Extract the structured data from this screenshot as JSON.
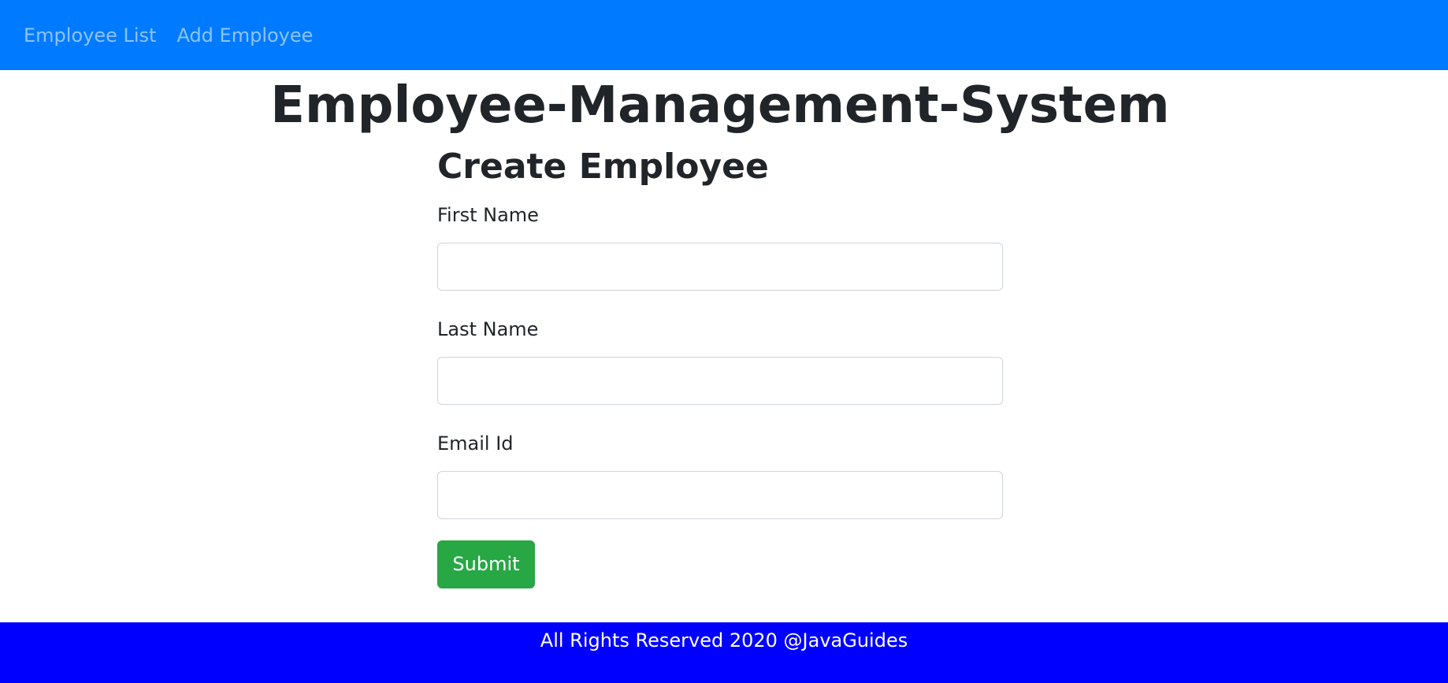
{
  "colors": {
    "navbar_bg": "#007bff",
    "nav_link": "#a6cbff",
    "heading": "#212529",
    "input_border": "#ced4da",
    "submit_bg": "#28a745",
    "footer_bg": "#0000ff",
    "footer_text": "#ffffff"
  },
  "navbar": {
    "links": [
      {
        "label": "Employee List"
      },
      {
        "label": "Add Employee"
      }
    ]
  },
  "header": {
    "title": "Employee-Management-System"
  },
  "form": {
    "title": "Create Employee",
    "fields": [
      {
        "label": "First Name",
        "value": ""
      },
      {
        "label": "Last Name",
        "value": ""
      },
      {
        "label": "Email Id",
        "value": ""
      }
    ],
    "submit_label": "Submit"
  },
  "footer": {
    "text": "All Rights Reserved 2020 @JavaGuides"
  }
}
